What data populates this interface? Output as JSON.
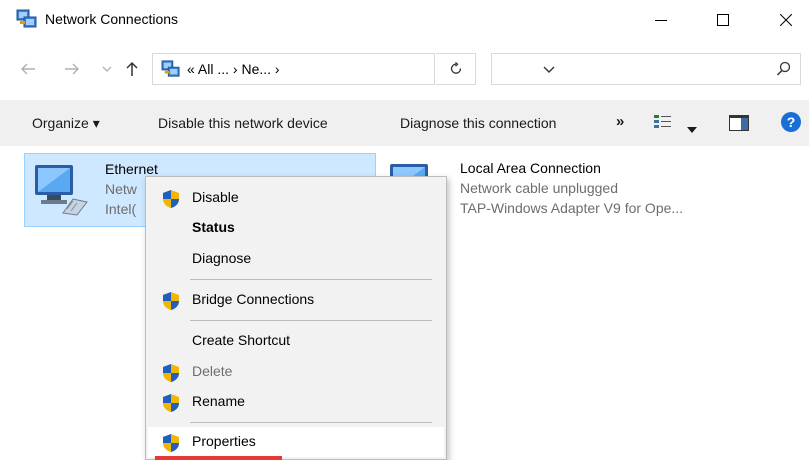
{
  "window": {
    "title": "Network Connections",
    "icon": "network-connections-icon"
  },
  "address_bar": {
    "breadcrumb": "« All ... › Ne... ›",
    "search_placeholder": ""
  },
  "command_bar": {
    "organize": "Organize ▾",
    "disable_device": "Disable this network device",
    "diagnose": "Diagnose this connection",
    "more": "»"
  },
  "connections": [
    {
      "name": "Ethernet",
      "status": "Netw",
      "adapter": "Intel(",
      "selected": true
    },
    {
      "name": "Local Area Connection",
      "status": "Network cable unplugged",
      "adapter": "TAP-Windows Adapter V9 for Ope..."
    }
  ],
  "context_menu": {
    "items": [
      {
        "label": "Disable",
        "shield": true
      },
      {
        "label": "Status",
        "bold": true
      },
      {
        "label": "Diagnose"
      },
      {
        "label": "Bridge Connections",
        "shield": true
      },
      {
        "label": "Create Shortcut"
      },
      {
        "label": "Delete",
        "shield": true,
        "disabled": true
      },
      {
        "label": "Rename",
        "shield": true
      },
      {
        "label": "Properties",
        "shield": true,
        "hovered": true
      }
    ]
  },
  "colors": {
    "selection_bg": "#cde8ff",
    "selection_border": "#99d1ff",
    "command_bar_bg": "#f0f0f0",
    "help_blue": "#1a6fd6",
    "highlight_red": "#e53935"
  }
}
